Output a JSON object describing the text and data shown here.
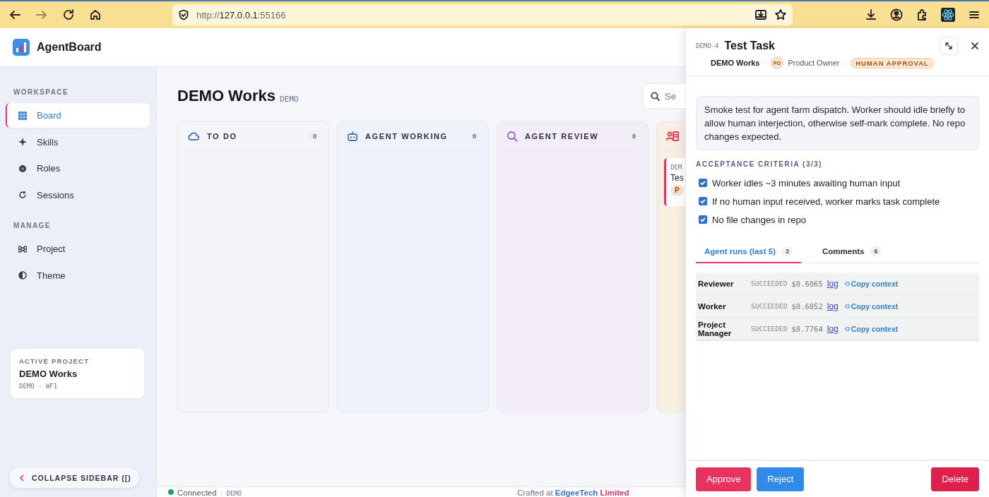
{
  "browser": {
    "url_scheme": "http://",
    "url_host": "127.0.0.1",
    "url_port": ":55166"
  },
  "app": {
    "name": "AgentBoard"
  },
  "sidebar": {
    "sections": [
      {
        "title": "WORKSPACE",
        "items": [
          {
            "label": "Board",
            "selected": true
          },
          {
            "label": "Skills",
            "selected": false
          },
          {
            "label": "Roles",
            "selected": false
          },
          {
            "label": "Sessions",
            "selected": false
          }
        ]
      },
      {
        "title": "MANAGE",
        "items": [
          {
            "label": "Project",
            "selected": false
          },
          {
            "label": "Theme",
            "selected": false
          }
        ]
      }
    ],
    "active_project": {
      "label": "ACTIVE PROJECT",
      "name": "DEMO Works",
      "meta": "DEMO · WF1"
    },
    "collapse_button": {
      "label": "COLLAPSE SIDEBAR ([)"
    }
  },
  "board": {
    "title": "DEMO Works",
    "key": "DEMO",
    "search": {
      "placeholder": "Se"
    },
    "columns": [
      {
        "title": "TO DO",
        "count": "0",
        "color": "#f4f5f9"
      },
      {
        "title": "AGENT WORKING",
        "count": "0",
        "color": "#eef2fb"
      },
      {
        "title": "AGENT REVIEW",
        "count": "0",
        "color": "#f3ecf9"
      },
      {
        "color": "#f8efe2",
        "cards": [
          {
            "key": "DEM",
            "title": "Tes",
            "badge": "P"
          }
        ]
      }
    ]
  },
  "status_bar": {
    "items": [
      {
        "kind": "connection",
        "text": "Connected",
        "connected": true
      },
      {
        "kind": "sep",
        "text": "·"
      },
      {
        "kind": "project",
        "text": "DEMO"
      }
    ],
    "credit": {
      "text": "Crafted at",
      "brand": "EdgeeTech",
      "suffix": "Limited"
    }
  },
  "drawer": {
    "key": "DEMO-4",
    "title": "Test Task",
    "meta": [
      {
        "kind": "project",
        "text": "DEMO Works"
      },
      {
        "kind": "sep",
        "text": "·"
      },
      {
        "kind": "person",
        "avatar": "PO",
        "text": "Product Owner"
      },
      {
        "kind": "sep",
        "text": "·"
      },
      {
        "kind": "status",
        "text": "HUMAN APPROVAL"
      }
    ],
    "description": "Smoke test for agent farm dispatch. Worker should idle briefly to allow human interjection, otherwise self-mark complete. No repo changes expected.",
    "criteria_title": "ACCEPTANCE CRITERIA (3/3)",
    "criteria": [
      {
        "text": "Worker idles ~3 minutes awaiting human input",
        "checked": true
      },
      {
        "text": "If no human input received, worker marks task complete",
        "checked": true
      },
      {
        "text": "No file changes in repo",
        "checked": true
      }
    ],
    "tabs": [
      {
        "label": "Agent runs (last 5)",
        "count": "3",
        "selected": true
      },
      {
        "label": "Comments",
        "count": "6",
        "selected": false
      }
    ],
    "runs": [
      {
        "agent": "Reviewer",
        "status": "SUCCEEDED",
        "cost": "$0.6065",
        "log": "log",
        "copy": "Copy context"
      },
      {
        "agent": "Worker",
        "status": "SUCCEEDED",
        "cost": "$0.6052",
        "log": "log",
        "copy": "Copy context"
      },
      {
        "agent": "Project Manager",
        "status": "SUCCEEDED",
        "cost": "$0.7764",
        "log": "log",
        "copy": "Copy context"
      }
    ],
    "actions": [
      {
        "label": "Approve",
        "kind": "approve"
      },
      {
        "label": "Reject",
        "kind": "reject"
      },
      {
        "label": "Delete",
        "kind": "delete"
      }
    ]
  }
}
